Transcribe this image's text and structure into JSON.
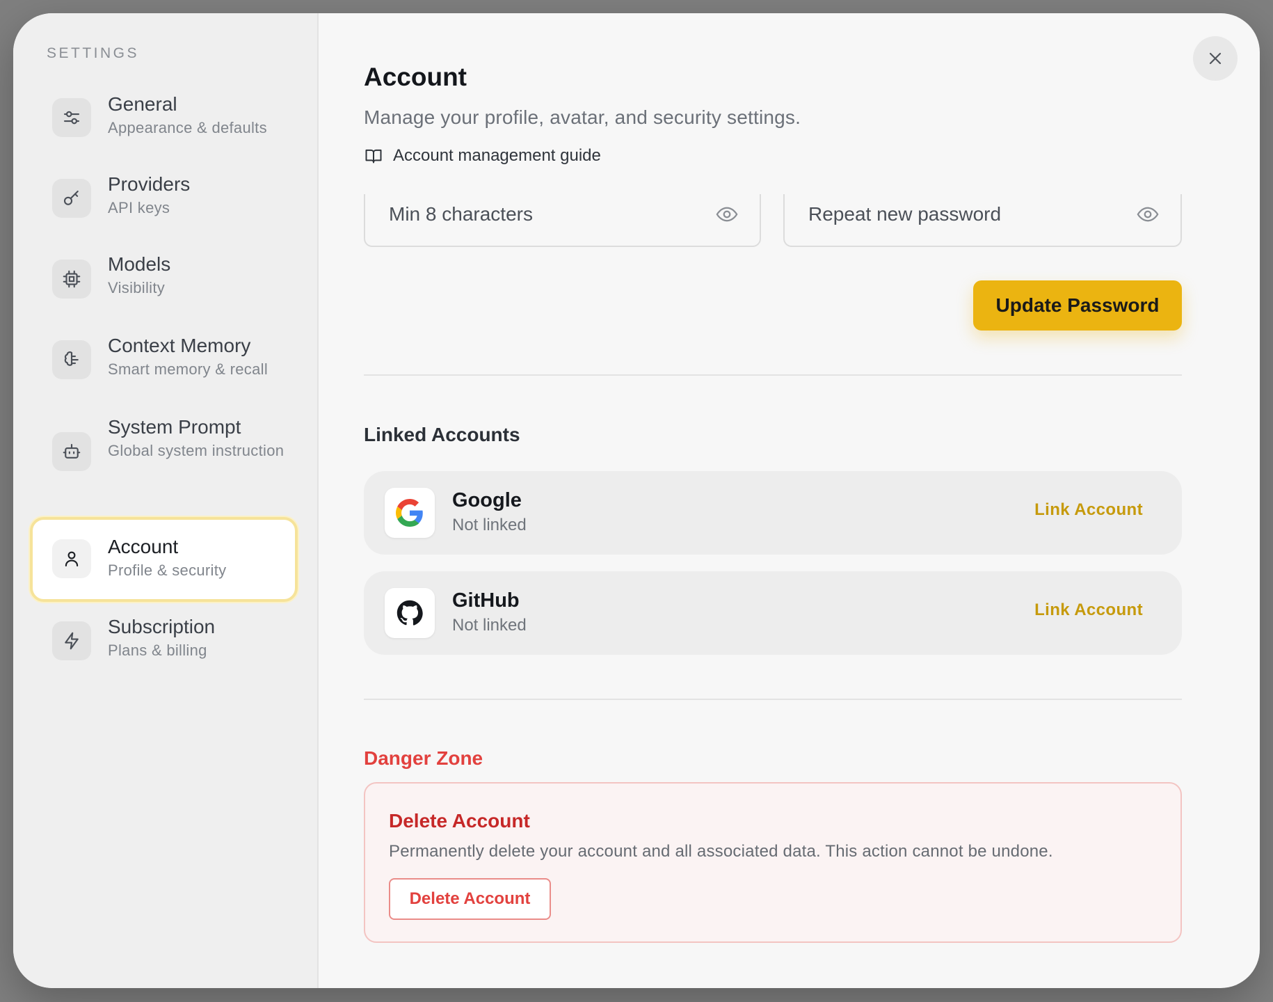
{
  "sidebar": {
    "heading": "SETTINGS",
    "items": [
      {
        "label": "General",
        "sub": "Appearance & defaults",
        "icon": "sliders-icon"
      },
      {
        "label": "Providers",
        "sub": "API keys",
        "icon": "key-icon"
      },
      {
        "label": "Models",
        "sub": "Visibility",
        "icon": "cpu-chip-icon"
      },
      {
        "label": "Context Memory",
        "sub": "Smart memory & recall",
        "icon": "brain-icon"
      },
      {
        "label": "System Prompt",
        "sub": "Global system instruction",
        "icon": "bot-icon"
      },
      {
        "label": "Account",
        "sub": "Profile & security",
        "icon": "user-icon",
        "active": true
      },
      {
        "label": "Subscription",
        "sub": "Plans & billing",
        "icon": "lightning-icon"
      }
    ]
  },
  "main": {
    "title": "Account",
    "description": "Manage your profile, avatar, and security settings.",
    "guide_link": "Account management guide",
    "new_password_placeholder": "Min 8 characters",
    "confirm_password_placeholder": "Repeat new password",
    "update_password_label": "Update Password",
    "linked_accounts_title": "Linked Accounts",
    "linked_accounts": [
      {
        "name": "Google",
        "status": "Not linked",
        "action": "Link Account",
        "icon": "google-icon"
      },
      {
        "name": "GitHub",
        "status": "Not linked",
        "action": "Link Account",
        "icon": "github-icon"
      }
    ],
    "danger_zone_title": "Danger Zone",
    "delete_title": "Delete Account",
    "delete_description": "Permanently delete your account and all associated data. This action cannot be undone.",
    "delete_button_label": "Delete Account"
  },
  "colors": {
    "accent": "#ebb411",
    "link_text": "#c69a0c",
    "danger": "#e2413e",
    "active_border": "#f6e39a"
  }
}
